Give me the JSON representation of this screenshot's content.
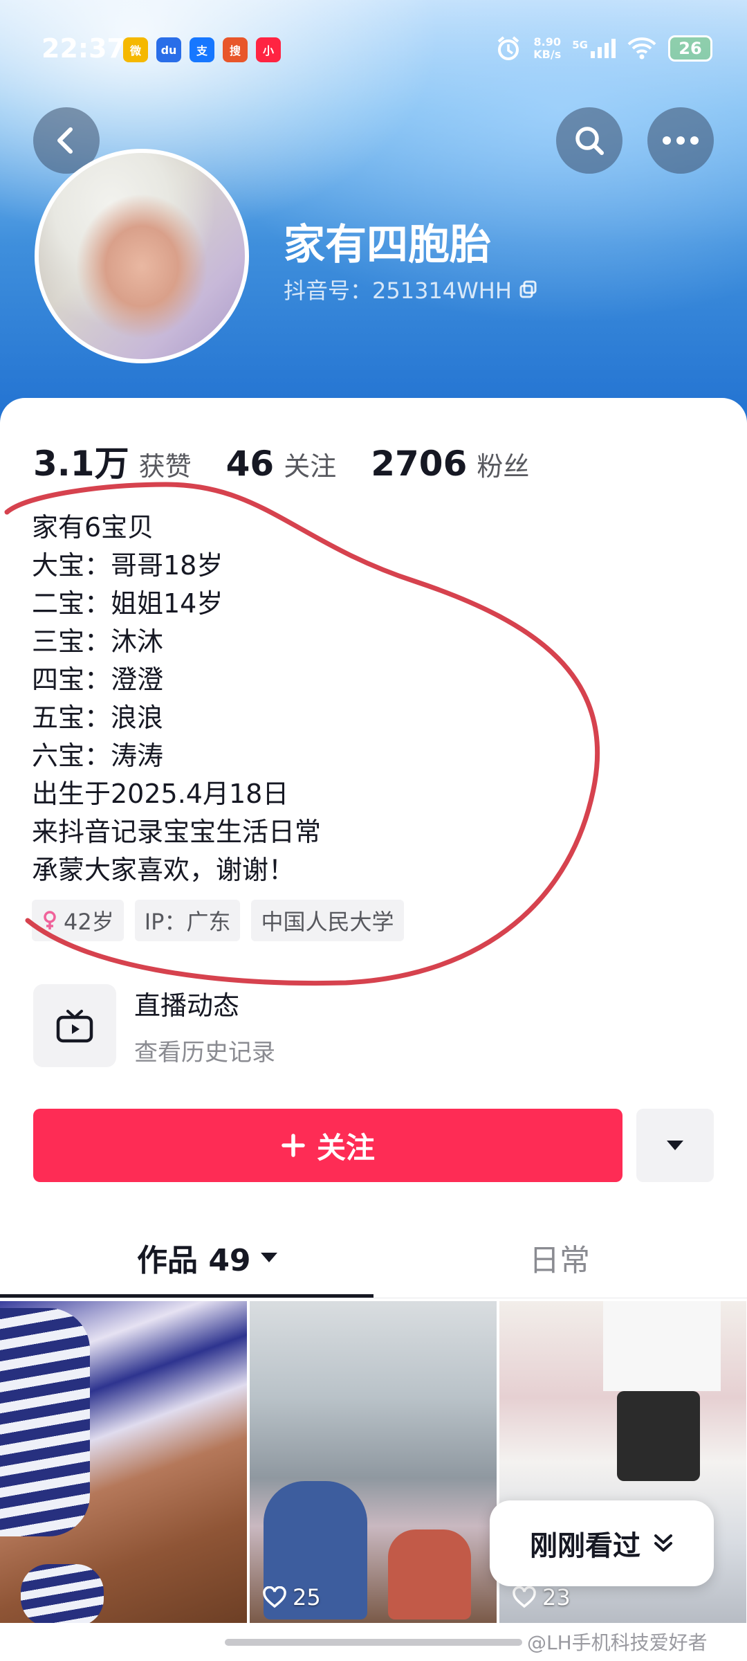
{
  "status_bar": {
    "time": "22:37",
    "apps": [
      {
        "icon": "weibo-icon",
        "label": "微",
        "color": "#f5b800"
      },
      {
        "icon": "baidu-icon",
        "label": "du",
        "color": "#2a6ee8"
      },
      {
        "icon": "alipay-icon",
        "label": "支",
        "color": "#1677ff"
      },
      {
        "icon": "sougou-icon",
        "label": "搜",
        "color": "#e8562a"
      },
      {
        "icon": "xiaohongshu-icon",
        "label": "小",
        "color": "#ff2442"
      }
    ],
    "net_speed_value": "8.90",
    "net_speed_unit": "KB/s",
    "signal": "5G",
    "battery": "26"
  },
  "profile": {
    "name": "家有四胞胎",
    "douyin_id": "抖音号：251314WHH"
  },
  "stats": [
    {
      "value": "3.1万",
      "label": "获赞"
    },
    {
      "value": "46",
      "label": "关注"
    },
    {
      "value": "2706",
      "label": "粉丝"
    }
  ],
  "bio": [
    "家有6宝贝",
    "大宝：哥哥18岁",
    "二宝：姐姐14岁",
    "三宝：沐沐",
    "四宝：澄澄",
    "五宝：浪浪",
    "六宝：涛涛",
    "出生于2025.4月18日",
    "来抖音记录宝宝生活日常",
    "承蒙大家喜欢，谢谢！"
  ],
  "tags": {
    "age": "42岁",
    "ip": "IP：广东",
    "school": "中国人民大学"
  },
  "live": {
    "title": "直播动态",
    "subtitle": "查看历史记录"
  },
  "actions": {
    "follow_label": "关注"
  },
  "tabs": {
    "works": "作品 49",
    "daily": "日常"
  },
  "videos": [
    {
      "likes": ""
    },
    {
      "likes": "25"
    },
    {
      "likes": "23"
    }
  ],
  "recent_label": "刚刚看过",
  "watermark": "@LH手机科技爱好者",
  "colors": {
    "accent": "#fe2c55",
    "annotation": "#d6424e"
  }
}
